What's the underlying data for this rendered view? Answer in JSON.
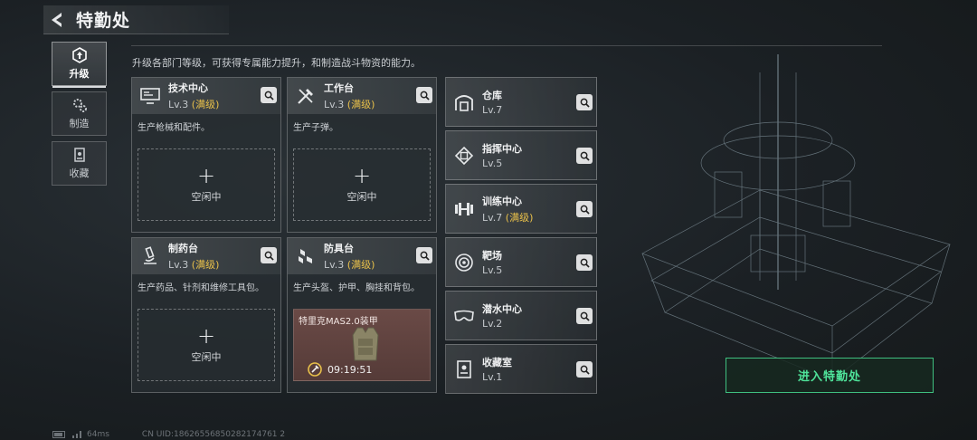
{
  "header": {
    "title": "特勤处"
  },
  "tabs": [
    {
      "label": "升级",
      "icon": "upgrade-icon",
      "active": true
    },
    {
      "label": "制造",
      "icon": "gears-icon",
      "active": false
    },
    {
      "label": "收藏",
      "icon": "collection-icon",
      "active": false
    }
  ],
  "description": "升级各部门等级，可获得专属能力提升，和制造战斗物资的能力。",
  "cards": [
    {
      "name": "技术中心",
      "level": "Lv.3",
      "max": "(满级)",
      "desc": "生产枪械和配件。",
      "slot_plus": "+",
      "slot_label": "空闲中",
      "icon": "monitor-icon"
    },
    {
      "name": "工作台",
      "level": "Lv.3",
      "max": "(满级)",
      "desc": "生产子弹。",
      "slot_plus": "+",
      "slot_label": "空闲中",
      "icon": "tools-icon"
    },
    {
      "name": "制药台",
      "level": "Lv.3",
      "max": "(满级)",
      "desc": "生产药品、针剂和维修工具包。",
      "slot_plus": "+",
      "slot_label": "空闲中",
      "icon": "microscope-icon"
    },
    {
      "name": "防具台",
      "level": "Lv.3",
      "max": "(满级)",
      "desc": "生产头盔、护甲、胸挂和背包。",
      "busy_item": "特里克MAS2.0装甲",
      "timer": "09:19:51",
      "icon": "boxes-icon"
    }
  ],
  "rows": [
    {
      "name": "仓库",
      "level": "Lv.7",
      "max": "",
      "icon": "warehouse-icon"
    },
    {
      "name": "指挥中心",
      "level": "Lv.5",
      "max": "",
      "icon": "chip-icon"
    },
    {
      "name": "训练中心",
      "level": "Lv.7",
      "max": "(满级)",
      "icon": "dumbbell-icon"
    },
    {
      "name": "靶场",
      "level": "Lv.5",
      "max": "",
      "icon": "target-icon"
    },
    {
      "name": "潜水中心",
      "level": "Lv.2",
      "max": "",
      "icon": "diving-mask-icon"
    },
    {
      "name": "收藏室",
      "level": "Lv.1",
      "max": "",
      "icon": "display-case-icon"
    }
  ],
  "enter_button": "进入特勤处",
  "footer": {
    "ping": "64ms",
    "uid": "CN UID:18626556850282174761 2"
  },
  "colors": {
    "accent_green": "#4fe39a",
    "max_level": "#e8c04a"
  }
}
